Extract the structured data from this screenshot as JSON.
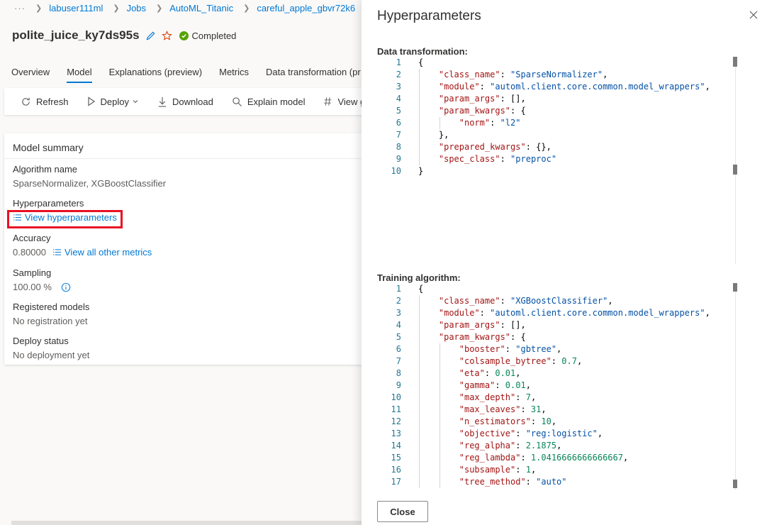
{
  "breadcrumb": {
    "more": "···",
    "items": [
      "labuser111ml",
      "Jobs",
      "AutoML_Titanic",
      "careful_apple_gbvr72k6"
    ]
  },
  "header": {
    "title": "polite_juice_ky7ds95s",
    "status": "Completed"
  },
  "tabs": [
    "Overview",
    "Model",
    "Explanations (preview)",
    "Metrics",
    "Data transformation (pr"
  ],
  "toolbar": {
    "refresh": "Refresh",
    "deploy": "Deploy",
    "download": "Download",
    "explain": "Explain model",
    "view": "View g"
  },
  "summary": {
    "title": "Model summary",
    "algorithm_label": "Algorithm name",
    "algorithm_value": "SparseNormalizer, XGBoostClassifier",
    "hyper_label": "Hyperparameters",
    "hyper_link": "View hyperparameters",
    "accuracy_label": "Accuracy",
    "accuracy_value": "0.80000",
    "metrics_link": "View all other metrics",
    "sampling_label": "Sampling",
    "sampling_value": "100.00 %",
    "registered_label": "Registered models",
    "registered_value": "No registration yet",
    "deploy_label": "Deploy status",
    "deploy_value": "No deployment yet"
  },
  "panel": {
    "title": "Hyperparameters",
    "data_transformation_label": "Data transformation:",
    "training_algorithm_label": "Training algorithm:",
    "close_label": "Close"
  },
  "data_transformation_code": [
    {
      "n": "1",
      "text": "{"
    },
    {
      "n": "2",
      "text": "\"class_name\": \"SparseNormalizer\","
    },
    {
      "n": "3",
      "text": "\"module\": \"automl.client.core.common.model_wrappers\","
    },
    {
      "n": "4",
      "text": "\"param_args\": [],"
    },
    {
      "n": "5",
      "text": "\"param_kwargs\": {"
    },
    {
      "n": "6",
      "text": "\"norm\": \"l2\""
    },
    {
      "n": "7",
      "text": "},"
    },
    {
      "n": "8",
      "text": "\"prepared_kwargs\": {},"
    },
    {
      "n": "9",
      "text": "\"spec_class\": \"preproc\""
    },
    {
      "n": "10",
      "text": "}"
    }
  ],
  "training_algorithm_code": [
    {
      "n": "1",
      "text": "{"
    },
    {
      "n": "2",
      "text": "\"class_name\": \"XGBoostClassifier\","
    },
    {
      "n": "3",
      "text": "\"module\": \"automl.client.core.common.model_wrappers\","
    },
    {
      "n": "4",
      "text": "\"param_args\": [],"
    },
    {
      "n": "5",
      "text": "\"param_kwargs\": {"
    },
    {
      "n": "6",
      "text": "\"booster\": \"gbtree\","
    },
    {
      "n": "7",
      "text": "\"colsample_bytree\": 0.7,"
    },
    {
      "n": "8",
      "text": "\"eta\": 0.01,"
    },
    {
      "n": "9",
      "text": "\"gamma\": 0.01,"
    },
    {
      "n": "10",
      "text": "\"max_depth\": 7,"
    },
    {
      "n": "11",
      "text": "\"max_leaves\": 31,"
    },
    {
      "n": "12",
      "text": "\"n_estimators\": 10,"
    },
    {
      "n": "13",
      "text": "\"objective\": \"reg:logistic\","
    },
    {
      "n": "14",
      "text": "\"reg_alpha\": 2.1875,"
    },
    {
      "n": "15",
      "text": "\"reg_lambda\": 1.0416666666666667,"
    },
    {
      "n": "16",
      "text": "\"subsample\": 1,"
    },
    {
      "n": "17",
      "text": "\"tree_method\": \"auto\""
    }
  ],
  "colors": {
    "accent": "#0078d4",
    "status_green": "#57a300",
    "highlight_red": "#e81123",
    "json_key": "#a31515",
    "json_string": "#0451a5",
    "json_number": "#098658",
    "line_number": "#237893"
  }
}
